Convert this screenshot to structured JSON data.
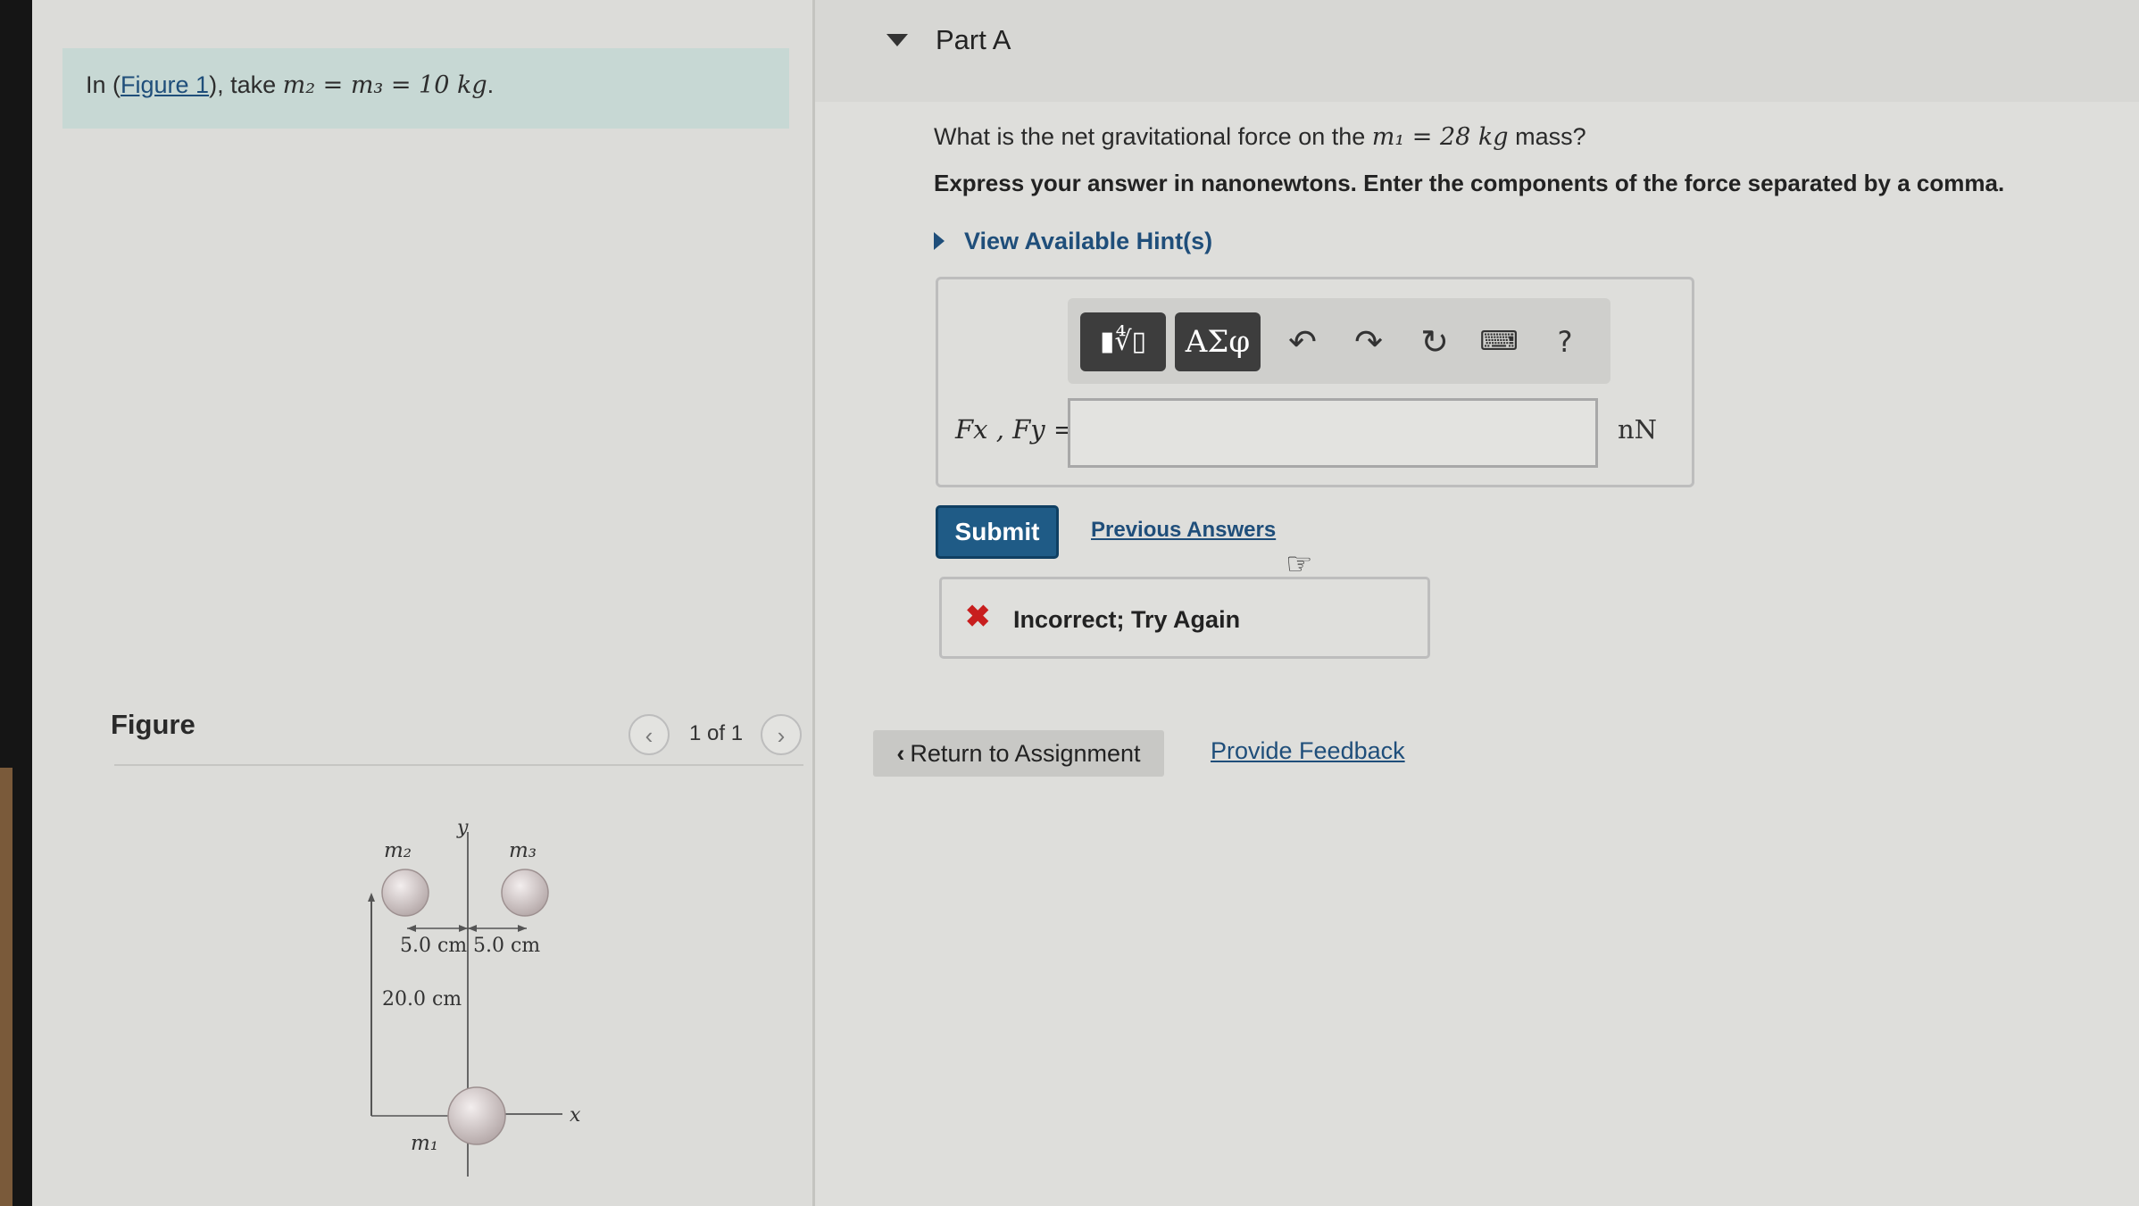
{
  "left": {
    "intro": {
      "prefix": "In (",
      "link": "Figure 1",
      "middle": "), take ",
      "equation": "m₂ = m₃ = 10 kg",
      "suffix": "."
    },
    "figure": {
      "heading": "Figure",
      "counter": "1 of 1",
      "prev_icon": "chevron-left-icon",
      "next_icon": "chevron-right-icon",
      "diagram": {
        "axis_y": "y",
        "axis_x": "x",
        "m1": "m₁",
        "m2": "m₂",
        "m3": "m₃",
        "dim_left": "5.0 cm",
        "dim_right": "5.0 cm",
        "dim_vertical": "20.0 cm"
      }
    }
  },
  "part": {
    "title": "Part A",
    "question_prefix": "What is the net gravitational force on the ",
    "question_math": "m₁ = 28 kg",
    "question_suffix": " mass?",
    "instruction": "Express your answer in nanonewtons. Enter the components of the force separated by a comma.",
    "hint_label": "View Available Hint(s)"
  },
  "answer": {
    "toolbar": {
      "template_label": "▮∜▯",
      "greek_label": "ΑΣφ",
      "undo_icon": "undo-icon",
      "redo_icon": "redo-icon",
      "reset_icon": "reset-icon",
      "keyboard_icon": "keyboard-icon",
      "help_label": "?"
    },
    "variable_label": "Fx , Fy =",
    "input_value": "",
    "unit": "nN"
  },
  "actions": {
    "submit_label": "Submit",
    "previous_answers_label": "Previous Answers"
  },
  "feedback": {
    "status": "Incorrect; Try Again",
    "status_color": "#c81e1e"
  },
  "footer": {
    "return_label": "Return to Assignment",
    "provide_feedback_label": "Provide Feedback"
  }
}
